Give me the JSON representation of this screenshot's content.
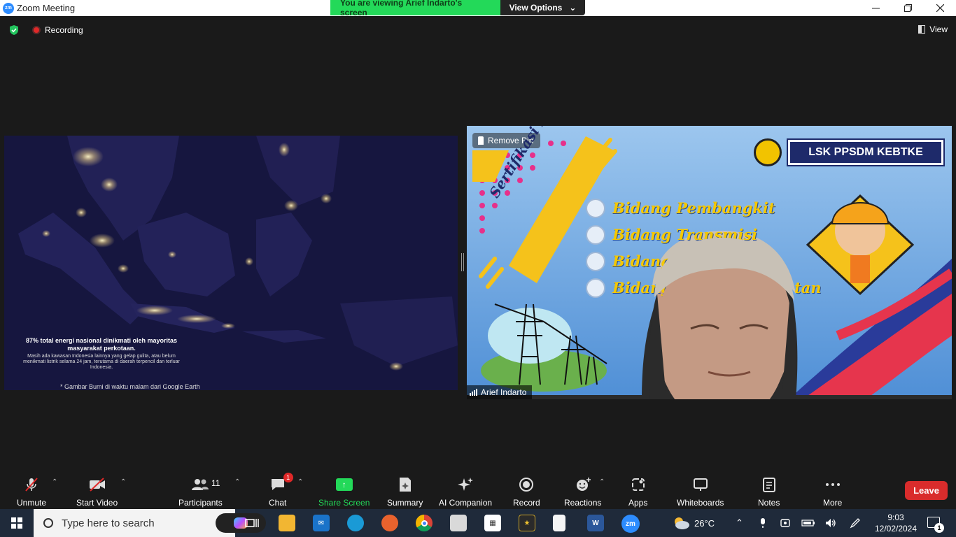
{
  "window": {
    "title": "Zoom Meeting",
    "share_banner": "You are viewing Arief Indarto's screen",
    "view_options": "View Options"
  },
  "topbar": {
    "recording": "Recording",
    "view": "View"
  },
  "shared_screen": {
    "caption_title": "87% total energi nasional dinikmati oleh mayoritas masyarakat perkotaan.",
    "caption_body": "Masih ada kawasan Indonesia lainnya yang gelap gulita, atau belum menikmati listrik selama 24 jam, terutama di daerah terpencil dan terluar Indonesia.",
    "footnote": "* Gambar Bumi di waktu malam dari Google Earth"
  },
  "video": {
    "remove_pin": "Remove Pin",
    "logo_text": "LSK PPSDM KEBTKE",
    "banner_text": "Sertifikasi Kompetensi",
    "bidang": [
      "Bidang Pembangkit",
      "Bidang Transmisi",
      "Bidang",
      "Bidang"
    ],
    "bidang_tail": "tan",
    "participant_name": "Arief Indarto"
  },
  "toolbar": {
    "unmute": "Unmute",
    "start_video": "Start Video",
    "participants": "Participants",
    "participants_count": "11",
    "chat": "Chat",
    "chat_badge": "1",
    "share_screen": "Share Screen",
    "summary": "Summary",
    "ai_companion": "AI Companion",
    "record": "Record",
    "reactions": "Reactions",
    "apps": "Apps",
    "whiteboards": "Whiteboards",
    "notes": "Notes",
    "more": "More",
    "leave": "Leave"
  },
  "taskbar": {
    "search_placeholder": "Type here to search",
    "weather": "26°C",
    "time": "9:03",
    "date": "12/02/2024",
    "notifications": "1"
  },
  "colors": {
    "zoom_blue": "#2d8cff",
    "share_green": "#23d959",
    "leave_red": "#d92c2c",
    "toolbar_bg": "#1a1a1a"
  }
}
